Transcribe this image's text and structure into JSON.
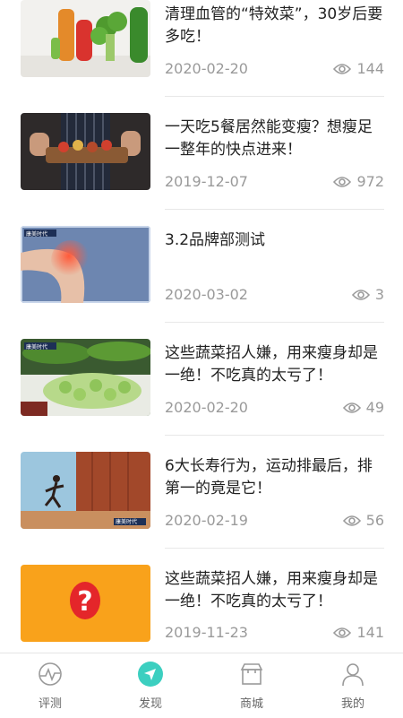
{
  "feed": {
    "items": [
      {
        "title": "清理血管的“特效菜”，30岁后要多吃！",
        "date": "2020-02-20",
        "views": "144",
        "thumb": "vegetables"
      },
      {
        "title": "一天吃5餐居然能变瘦？想瘦足一整年的快点进来！",
        "date": "2019-12-07",
        "views": "972",
        "thumb": "chef-plate"
      },
      {
        "title": "3.2品牌部测试",
        "date": "2020-03-02",
        "views": "3",
        "thumb": "knee-pain"
      },
      {
        "title": "这些蔬菜招人嫌，用来瘦身却是一绝！不吃真的太亏了！",
        "date": "2020-02-20",
        "views": "49",
        "thumb": "bitter-melon"
      },
      {
        "title": "6大长寿行为，运动排最后，排第一的竟是它！",
        "date": "2020-02-19",
        "views": "56",
        "thumb": "runner"
      },
      {
        "title": "这些蔬菜招人嫌，用来瘦身却是一绝！不吃真的太亏了！",
        "date": "2019-11-23",
        "views": "141",
        "thumb": "question-mark"
      }
    ]
  },
  "thumb_text": {
    "brand": "康美时代",
    "question": "?"
  },
  "tabbar": {
    "tabs": [
      {
        "label": "评测",
        "icon": "pulse-icon"
      },
      {
        "label": "发现",
        "icon": "discover-icon"
      },
      {
        "label": "商城",
        "icon": "shop-icon"
      },
      {
        "label": "我的",
        "icon": "user-icon"
      }
    ]
  },
  "colors": {
    "accent": "#3ccfc0",
    "text": "#222222",
    "meta": "#9a9a9a",
    "divider": "#e8e8e8"
  }
}
